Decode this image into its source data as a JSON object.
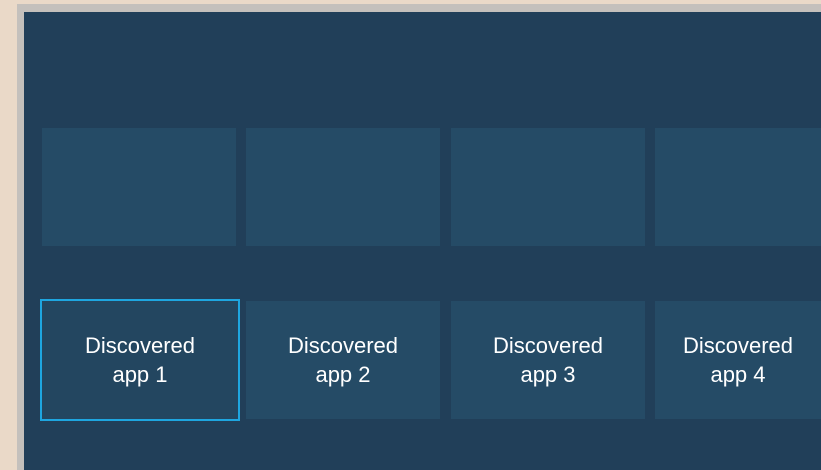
{
  "colors": {
    "background": "#ead9c8",
    "frame": "#c4c0bc",
    "panel": "#213f59",
    "tile": "#254b66",
    "focus_border": "#1ea6e0",
    "text": "#ffffff"
  },
  "featured_row": {
    "tiles": [
      "",
      "",
      "",
      ""
    ]
  },
  "discovered_apps": {
    "selected_index": 0,
    "items": [
      {
        "label": "Discovered\napp 1"
      },
      {
        "label": "Discovered\napp 2"
      },
      {
        "label": "Discovered\napp 3"
      },
      {
        "label": "Discovered\napp 4"
      }
    ]
  }
}
